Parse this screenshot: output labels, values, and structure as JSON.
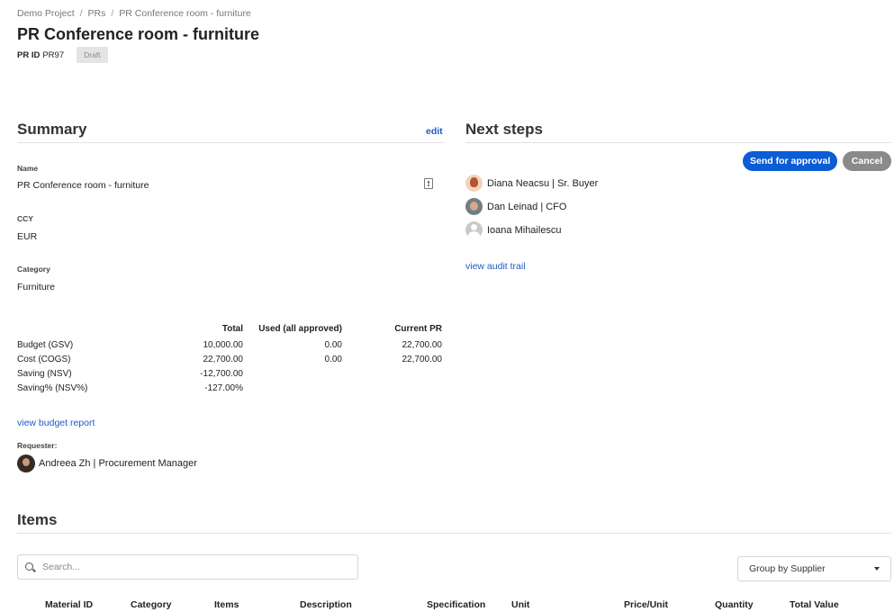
{
  "breadcrumb": {
    "items": [
      "Demo Project",
      "PRs",
      "PR Conference room - furniture"
    ],
    "separator": "/"
  },
  "page": {
    "title": "PR Conference room - furniture",
    "pr_id_label": "PR ID",
    "pr_id_value": "PR97",
    "status": "Draft"
  },
  "summary": {
    "title": "Summary",
    "edit_label": "edit",
    "fields": {
      "name_label": "Name",
      "name_value": "PR Conference room - furniture",
      "ccy_label": "CCY",
      "ccy_value": "EUR",
      "category_label": "Category",
      "category_value": "Furniture"
    },
    "budget": {
      "headers": [
        "",
        "Total",
        "Used (all approved)",
        "Current PR"
      ],
      "rows": [
        [
          "Budget (GSV)",
          "10,000.00",
          "0.00",
          "22,700.00"
        ],
        [
          "Cost (COGS)",
          "22,700.00",
          "0.00",
          "22,700.00"
        ],
        [
          "Saving (NSV)",
          "-12,700.00",
          "",
          ""
        ],
        [
          "Saving% (NSV%)",
          "-127.00%",
          "",
          ""
        ]
      ]
    },
    "budget_report_link": "view budget report",
    "requester_label": "Requester:",
    "requester_name": "Andreea Zh | Procurement Manager"
  },
  "next_steps": {
    "title": "Next steps",
    "send_label": "Send for approval",
    "cancel_label": "Cancel",
    "approvers": [
      {
        "name": "Diana Neacsu | Sr. Buyer"
      },
      {
        "name": "Dan Leinad | CFO"
      },
      {
        "name": "Ioana Mihailescu"
      }
    ],
    "audit_link": "view audit trail"
  },
  "items": {
    "title": "Items",
    "search_placeholder": "Search...",
    "group_by": "Group by Supplier",
    "columns": [
      "Material ID",
      "Category",
      "Items",
      "Description",
      "Specification",
      "Unit",
      "Price/Unit",
      "Quantity",
      "Total Value"
    ]
  },
  "colors": {
    "primary": "#0b5cd5",
    "link": "#1f5bc6",
    "cancel": "#8a8a8a",
    "badge_bg": "#e4e4e4"
  }
}
